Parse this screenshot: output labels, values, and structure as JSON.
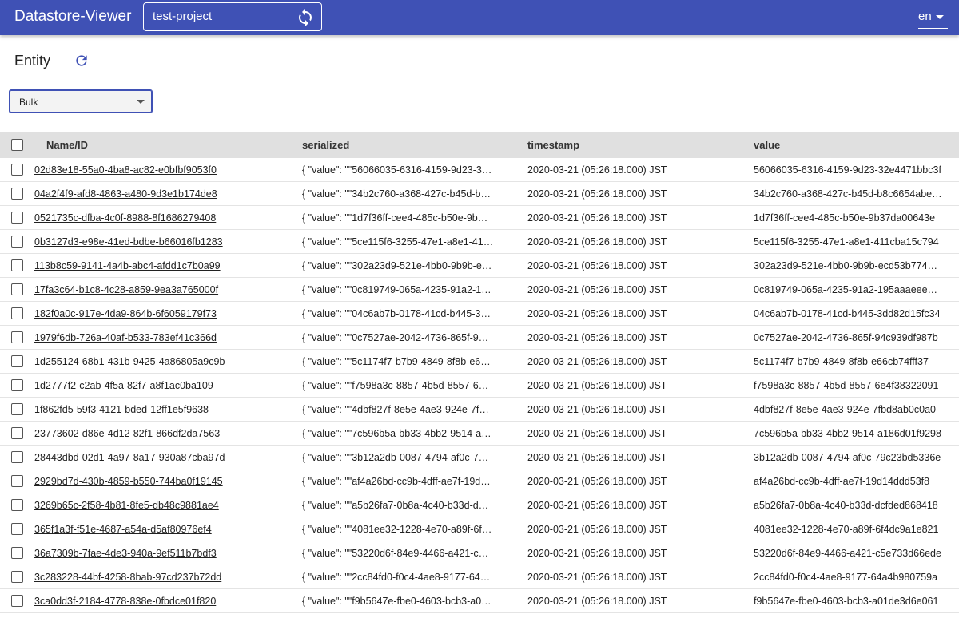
{
  "appbar": {
    "title": "Datastore-Viewer",
    "project_value": "test-project",
    "reload_icon": "sync-icon",
    "lang": "en"
  },
  "entity": {
    "title": "Entity",
    "refresh_icon": "refresh-icon",
    "kind_selected": "Bulk"
  },
  "colors": {
    "appbar": "#3f51b5",
    "header_row": "#e0e0e0"
  },
  "table": {
    "columns": [
      "Name/ID",
      "serialized",
      "timestamp",
      "value"
    ],
    "rows": [
      {
        "name": "02d83e18-55a0-4ba8-ac82-e0bfbf9053f0",
        "serialized": "{ \"value\": \"\"56066035-6316-4159-9d23-3…",
        "timestamp": "2020-03-21 (05:26:18.000) JST",
        "value": "56066035-6316-4159-9d23-32e4471bbc3f"
      },
      {
        "name": "04a2f4f9-afd8-4863-a480-9d3e1b174de8",
        "serialized": "{ \"value\": \"\"34b2c760-a368-427c-b45d-b…",
        "timestamp": "2020-03-21 (05:26:18.000) JST",
        "value": "34b2c760-a368-427c-b45d-b8c6654abe…"
      },
      {
        "name": "0521735c-dfba-4c0f-8988-8f1686279408",
        "serialized": "{ \"value\": \"\"1d7f36ff-cee4-485c-b50e-9b…",
        "timestamp": "2020-03-21 (05:26:18.000) JST",
        "value": "1d7f36ff-cee4-485c-b50e-9b37da00643e"
      },
      {
        "name": "0b3127d3-e98e-41ed-bdbe-b66016fb1283",
        "serialized": "{ \"value\": \"\"5ce115f6-3255-47e1-a8e1-41…",
        "timestamp": "2020-03-21 (05:26:18.000) JST",
        "value": "5ce115f6-3255-47e1-a8e1-411cba15c794"
      },
      {
        "name": "113b8c59-9141-4a4b-abc4-afdd1c7b0a99",
        "serialized": "{ \"value\": \"\"302a23d9-521e-4bb0-9b9b-e…",
        "timestamp": "2020-03-21 (05:26:18.000) JST",
        "value": "302a23d9-521e-4bb0-9b9b-ecd53b774…"
      },
      {
        "name": "17fa3c64-b1c8-4c28-a859-9ea3a765000f",
        "serialized": "{ \"value\": \"\"0c819749-065a-4235-91a2-1…",
        "timestamp": "2020-03-21 (05:26:18.000) JST",
        "value": "0c819749-065a-4235-91a2-195aaaeee…"
      },
      {
        "name": "182f0a0c-917e-4da9-864b-6f6059179f73",
        "serialized": "{ \"value\": \"\"04c6ab7b-0178-41cd-b445-3…",
        "timestamp": "2020-03-21 (05:26:18.000) JST",
        "value": "04c6ab7b-0178-41cd-b445-3dd82d15fc34"
      },
      {
        "name": "1979f6db-726a-40af-b533-783ef41c366d",
        "serialized": "{ \"value\": \"\"0c7527ae-2042-4736-865f-9…",
        "timestamp": "2020-03-21 (05:26:18.000) JST",
        "value": "0c7527ae-2042-4736-865f-94c939df987b"
      },
      {
        "name": "1d255124-68b1-431b-9425-4a86805a9c9b",
        "serialized": "{ \"value\": \"\"5c1174f7-b7b9-4849-8f8b-e6…",
        "timestamp": "2020-03-21 (05:26:18.000) JST",
        "value": "5c1174f7-b7b9-4849-8f8b-e66cb74fff37"
      },
      {
        "name": "1d2777f2-c2ab-4f5a-82f7-a8f1ac0ba109",
        "serialized": "{ \"value\": \"\"f7598a3c-8857-4b5d-8557-6…",
        "timestamp": "2020-03-21 (05:26:18.000) JST",
        "value": "f7598a3c-8857-4b5d-8557-6e4f38322091"
      },
      {
        "name": "1f862fd5-59f3-4121-bded-12ff1e5f9638",
        "serialized": "{ \"value\": \"\"4dbf827f-8e5e-4ae3-924e-7f…",
        "timestamp": "2020-03-21 (05:26:18.000) JST",
        "value": "4dbf827f-8e5e-4ae3-924e-7fbd8ab0c0a0"
      },
      {
        "name": "23773602-d86e-4d12-82f1-866df2da7563",
        "serialized": "{ \"value\": \"\"7c596b5a-bb33-4bb2-9514-a…",
        "timestamp": "2020-03-21 (05:26:18.000) JST",
        "value": "7c596b5a-bb33-4bb2-9514-a186d01f9298"
      },
      {
        "name": "28443dbd-02d1-4a97-8a17-930a87cba97d",
        "serialized": "{ \"value\": \"\"3b12a2db-0087-4794-af0c-7…",
        "timestamp": "2020-03-21 (05:26:18.000) JST",
        "value": "3b12a2db-0087-4794-af0c-79c23bd5336e"
      },
      {
        "name": "2929bd7d-430b-4859-b550-744ba0f19145",
        "serialized": "{ \"value\": \"\"af4a26bd-cc9b-4dff-ae7f-19d…",
        "timestamp": "2020-03-21 (05:26:18.000) JST",
        "value": "af4a26bd-cc9b-4dff-ae7f-19d14ddd53f8"
      },
      {
        "name": "3269b65c-2f58-4b81-8fe5-db48c9881ae4",
        "serialized": "{ \"value\": \"\"a5b26fa7-0b8a-4c40-b33d-d…",
        "timestamp": "2020-03-21 (05:26:18.000) JST",
        "value": "a5b26fa7-0b8a-4c40-b33d-dcfded868418"
      },
      {
        "name": "365f1a3f-f51e-4687-a54a-d5af80976ef4",
        "serialized": "{ \"value\": \"\"4081ee32-1228-4e70-a89f-6f…",
        "timestamp": "2020-03-21 (05:26:18.000) JST",
        "value": "4081ee32-1228-4e70-a89f-6f4dc9a1e821"
      },
      {
        "name": "36a7309b-7fae-4de3-940a-9ef511b7bdf3",
        "serialized": "{ \"value\": \"\"53220d6f-84e9-4466-a421-c…",
        "timestamp": "2020-03-21 (05:26:18.000) JST",
        "value": "53220d6f-84e9-4466-a421-c5e733d66ede"
      },
      {
        "name": "3c283228-44bf-4258-8bab-97cd237b72dd",
        "serialized": "{ \"value\": \"\"2cc84fd0-f0c4-4ae8-9177-64…",
        "timestamp": "2020-03-21 (05:26:18.000) JST",
        "value": "2cc84fd0-f0c4-4ae8-9177-64a4b980759a"
      },
      {
        "name": "3ca0dd3f-2184-4778-838e-0fbdce01f820",
        "serialized": "{ \"value\": \"\"f9b5647e-fbe0-4603-bcb3-a0…",
        "timestamp": "2020-03-21 (05:26:18.000) JST",
        "value": "f9b5647e-fbe0-4603-bcb3-a01de3d6e061"
      }
    ]
  }
}
